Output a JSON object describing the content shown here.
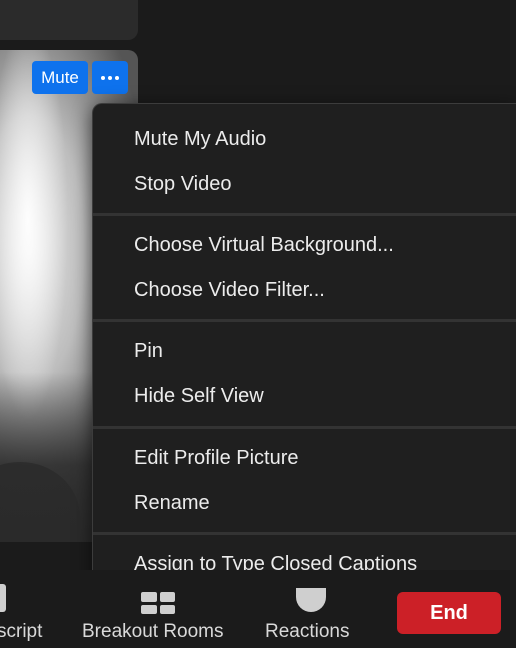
{
  "video_tile": {
    "mute_label": "Mute",
    "more_icon": "ellipsis-icon"
  },
  "context_menu": {
    "items": [
      "Mute My Audio",
      "Stop Video",
      "Choose Virtual Background...",
      "Choose Video Filter...",
      "Pin",
      "Hide Self View",
      "Edit Profile Picture",
      "Rename",
      "Assign to Type Closed Captions"
    ]
  },
  "toolbar": {
    "transcript_label": "script",
    "breakout_label": "Breakout Rooms",
    "reactions_label": "Reactions",
    "end_label": "End",
    "end_color": "#cc2027"
  },
  "colors": {
    "accent": "#0e72ed",
    "menu_bg": "#1f1f1f"
  }
}
